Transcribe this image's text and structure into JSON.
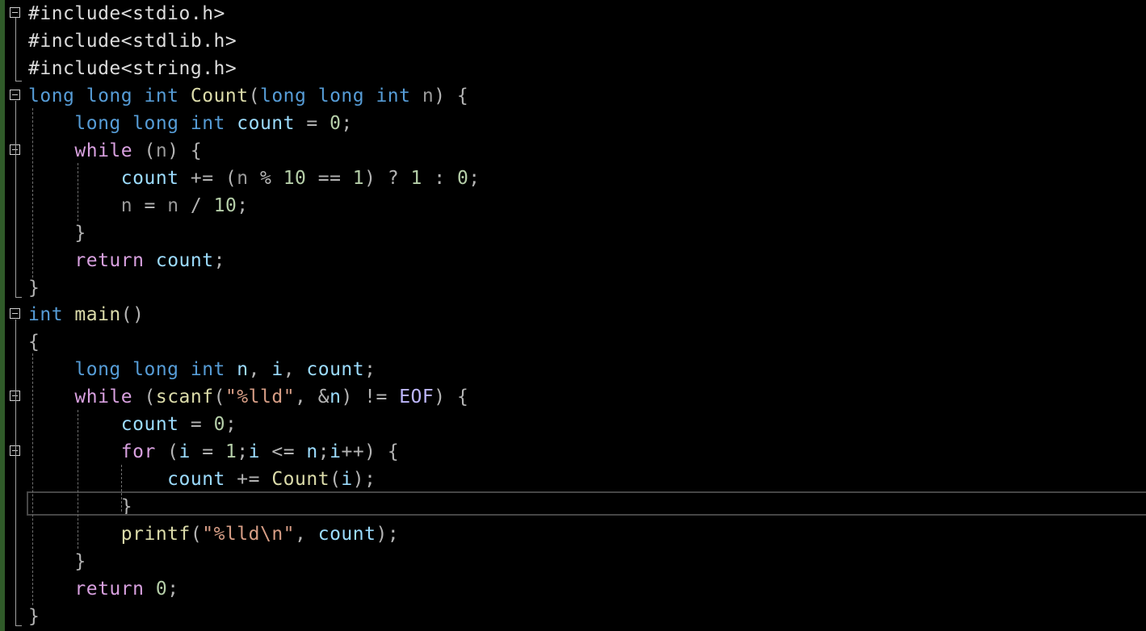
{
  "editor": {
    "theme": {
      "background": "#000000",
      "keyword": "#569cd6",
      "control": "#d8a0df",
      "function": "#dcdcaa",
      "variable": "#9cdcfe",
      "number": "#b5cea8",
      "string": "#d69d85"
    },
    "lines": [
      {
        "fold": true,
        "tokens": [
          {
            "t": "#include",
            "c": "plain"
          },
          {
            "t": "<stdio.h>",
            "c": "plain"
          }
        ]
      },
      {
        "fold": false,
        "tokens": [
          {
            "t": "#include",
            "c": "plain"
          },
          {
            "t": "<stdlib.h>",
            "c": "plain"
          }
        ]
      },
      {
        "fold": false,
        "tokens": [
          {
            "t": "#include",
            "c": "plain"
          },
          {
            "t": "<string.h>",
            "c": "plain"
          }
        ]
      },
      {
        "fold": true,
        "tokens": [
          {
            "t": "long long int ",
            "c": "keyword"
          },
          {
            "t": "Count",
            "c": "func"
          },
          {
            "t": "(",
            "c": "punct"
          },
          {
            "t": "long long int ",
            "c": "keyword"
          },
          {
            "t": "n",
            "c": "param"
          },
          {
            "t": ") {",
            "c": "punct"
          }
        ]
      },
      {
        "fold": false,
        "tokens": [
          {
            "t": "    ",
            "c": "plain"
          },
          {
            "t": "long long int ",
            "c": "keyword"
          },
          {
            "t": "count",
            "c": "var"
          },
          {
            "t": " = ",
            "c": "punct"
          },
          {
            "t": "0",
            "c": "number"
          },
          {
            "t": ";",
            "c": "punct"
          }
        ]
      },
      {
        "fold": true,
        "tokens": [
          {
            "t": "    ",
            "c": "plain"
          },
          {
            "t": "while",
            "c": "control"
          },
          {
            "t": " (",
            "c": "punct"
          },
          {
            "t": "n",
            "c": "param"
          },
          {
            "t": ") {",
            "c": "punct"
          }
        ]
      },
      {
        "fold": false,
        "tokens": [
          {
            "t": "        ",
            "c": "plain"
          },
          {
            "t": "count",
            "c": "var"
          },
          {
            "t": " += (",
            "c": "punct"
          },
          {
            "t": "n",
            "c": "param"
          },
          {
            "t": " % ",
            "c": "punct"
          },
          {
            "t": "10",
            "c": "number"
          },
          {
            "t": " == ",
            "c": "punct"
          },
          {
            "t": "1",
            "c": "number"
          },
          {
            "t": ") ? ",
            "c": "punct"
          },
          {
            "t": "1",
            "c": "number"
          },
          {
            "t": " : ",
            "c": "punct"
          },
          {
            "t": "0",
            "c": "number"
          },
          {
            "t": ";",
            "c": "punct"
          }
        ]
      },
      {
        "fold": false,
        "tokens": [
          {
            "t": "        ",
            "c": "plain"
          },
          {
            "t": "n",
            "c": "param"
          },
          {
            "t": " = ",
            "c": "punct"
          },
          {
            "t": "n",
            "c": "param"
          },
          {
            "t": " / ",
            "c": "punct"
          },
          {
            "t": "10",
            "c": "number"
          },
          {
            "t": ";",
            "c": "punct"
          }
        ]
      },
      {
        "fold": false,
        "tokens": [
          {
            "t": "    }",
            "c": "punct"
          }
        ]
      },
      {
        "fold": false,
        "tokens": [
          {
            "t": "    ",
            "c": "plain"
          },
          {
            "t": "return",
            "c": "control"
          },
          {
            "t": " ",
            "c": "plain"
          },
          {
            "t": "count",
            "c": "var"
          },
          {
            "t": ";",
            "c": "punct"
          }
        ]
      },
      {
        "fold": false,
        "tokens": [
          {
            "t": "}",
            "c": "punct"
          }
        ]
      },
      {
        "fold": true,
        "tokens": [
          {
            "t": "int ",
            "c": "keyword"
          },
          {
            "t": "main",
            "c": "func"
          },
          {
            "t": "()",
            "c": "punct"
          }
        ]
      },
      {
        "fold": false,
        "tokens": [
          {
            "t": "{",
            "c": "punct"
          }
        ]
      },
      {
        "fold": false,
        "tokens": [
          {
            "t": "    ",
            "c": "plain"
          },
          {
            "t": "long long int ",
            "c": "keyword"
          },
          {
            "t": "n",
            "c": "var"
          },
          {
            "t": ", ",
            "c": "punct"
          },
          {
            "t": "i",
            "c": "var"
          },
          {
            "t": ", ",
            "c": "punct"
          },
          {
            "t": "count",
            "c": "var"
          },
          {
            "t": ";",
            "c": "punct"
          }
        ]
      },
      {
        "fold": true,
        "tokens": [
          {
            "t": "    ",
            "c": "plain"
          },
          {
            "t": "while",
            "c": "control"
          },
          {
            "t": " (",
            "c": "punct"
          },
          {
            "t": "scanf",
            "c": "func"
          },
          {
            "t": "(",
            "c": "punct"
          },
          {
            "t": "\"%lld\"",
            "c": "string"
          },
          {
            "t": ", &",
            "c": "punct"
          },
          {
            "t": "n",
            "c": "var"
          },
          {
            "t": ") != ",
            "c": "punct"
          },
          {
            "t": "EOF",
            "c": "macro-blue"
          },
          {
            "t": ") {",
            "c": "punct"
          }
        ]
      },
      {
        "fold": false,
        "tokens": [
          {
            "t": "        ",
            "c": "plain"
          },
          {
            "t": "count",
            "c": "var"
          },
          {
            "t": " = ",
            "c": "punct"
          },
          {
            "t": "0",
            "c": "number"
          },
          {
            "t": ";",
            "c": "punct"
          }
        ]
      },
      {
        "fold": true,
        "tokens": [
          {
            "t": "        ",
            "c": "plain"
          },
          {
            "t": "for",
            "c": "control"
          },
          {
            "t": " (",
            "c": "punct"
          },
          {
            "t": "i",
            "c": "var"
          },
          {
            "t": " = ",
            "c": "punct"
          },
          {
            "t": "1",
            "c": "number"
          },
          {
            "t": ";",
            "c": "punct"
          },
          {
            "t": "i",
            "c": "var"
          },
          {
            "t": " <= ",
            "c": "punct"
          },
          {
            "t": "n",
            "c": "var"
          },
          {
            "t": ";",
            "c": "punct"
          },
          {
            "t": "i",
            "c": "var"
          },
          {
            "t": "++) {",
            "c": "punct"
          }
        ]
      },
      {
        "fold": false,
        "tokens": [
          {
            "t": "            ",
            "c": "plain"
          },
          {
            "t": "count",
            "c": "var"
          },
          {
            "t": " += ",
            "c": "punct"
          },
          {
            "t": "Count",
            "c": "func"
          },
          {
            "t": "(",
            "c": "punct"
          },
          {
            "t": "i",
            "c": "var"
          },
          {
            "t": ");",
            "c": "punct"
          }
        ]
      },
      {
        "fold": false,
        "tokens": [
          {
            "t": "        }",
            "c": "punct"
          }
        ]
      },
      {
        "fold": false,
        "tokens": [
          {
            "t": "        ",
            "c": "plain"
          },
          {
            "t": "printf",
            "c": "func"
          },
          {
            "t": "(",
            "c": "punct"
          },
          {
            "t": "\"%lld\\n\"",
            "c": "string"
          },
          {
            "t": ", ",
            "c": "punct"
          },
          {
            "t": "count",
            "c": "var"
          },
          {
            "t": ");",
            "c": "punct"
          }
        ]
      },
      {
        "fold": false,
        "tokens": [
          {
            "t": "    }",
            "c": "punct"
          }
        ]
      },
      {
        "fold": false,
        "tokens": [
          {
            "t": "    ",
            "c": "plain"
          },
          {
            "t": "return",
            "c": "control"
          },
          {
            "t": " ",
            "c": "plain"
          },
          {
            "t": "0",
            "c": "number"
          },
          {
            "t": ";",
            "c": "punct"
          }
        ]
      },
      {
        "fold": false,
        "tokens": [
          {
            "t": "}",
            "c": "punct"
          }
        ]
      }
    ]
  }
}
